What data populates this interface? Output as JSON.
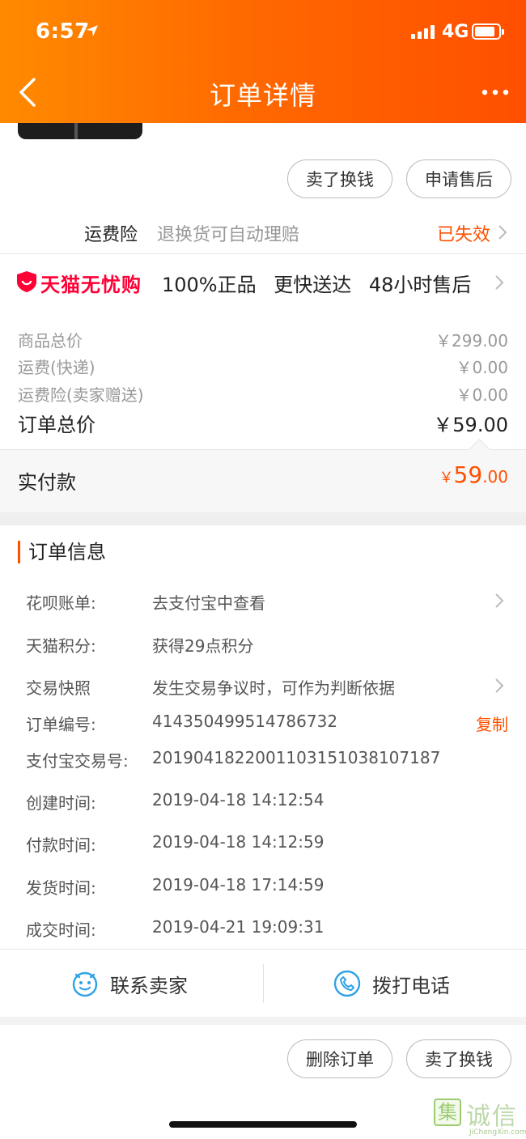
{
  "status_bar": {
    "time": "6:57",
    "network": "4G"
  },
  "nav": {
    "title": "订单详情"
  },
  "top_actions": {
    "sell_label": "卖了换钱",
    "after_sale_label": "申请售后"
  },
  "insurance": {
    "label": "运费险",
    "description": "退换货可自动理赔",
    "status": "已失效"
  },
  "tmall": {
    "brand": "天猫无忧购",
    "tags": "100%正品 更快送达 48小时售后"
  },
  "prices": {
    "goods_total": {
      "label": "商品总价",
      "value": "￥299.00"
    },
    "shipping": {
      "label": "运费(快递)",
      "value": "￥0.00"
    },
    "insurance": {
      "label": "运费险(卖家赠送)",
      "value": "￥0.00"
    },
    "order_total": {
      "label": "订单总价",
      "value": "￥59.00"
    }
  },
  "paid": {
    "label": "实付款",
    "currency": "￥",
    "integer": "59",
    "decimal": ".00"
  },
  "order_info": {
    "title": "订单信息",
    "rows": [
      {
        "key": "花呗账单:",
        "value": "去支付宝中查看"
      },
      {
        "key": "天猫积分:",
        "value": "获得29点积分"
      },
      {
        "key": "交易快照",
        "value": "发生交易争议时，可作为判断依据"
      },
      {
        "key": "订单编号:",
        "value": "414350499514786732",
        "action": "复制"
      },
      {
        "key": "支付宝交易号:",
        "value": "2019041822001103151038107187"
      },
      {
        "key": "创建时间:",
        "value": "2019-04-18 14:12:54"
      },
      {
        "key": "付款时间:",
        "value": "2019-04-18 14:12:59"
      },
      {
        "key": "发货时间:",
        "value": "2019-04-18 17:14:59"
      },
      {
        "key": "成交时间:",
        "value": "2019-04-21 19:09:31"
      }
    ]
  },
  "contact": {
    "seller_label": "联系卖家",
    "phone_label": "拨打电话"
  },
  "bottom_actions": {
    "delete_label": "删除订单",
    "sell_label": "卖了换钱"
  },
  "watermark": {
    "char": "集",
    "text": "诚信",
    "url_text": "JiChengXin.com"
  },
  "colors": {
    "accent": "#ff5000",
    "header_start": "#ff8a00",
    "header_end": "#ff4f00",
    "tmall_red": "#ff0036",
    "contact_blue": "#2fa3e6"
  }
}
